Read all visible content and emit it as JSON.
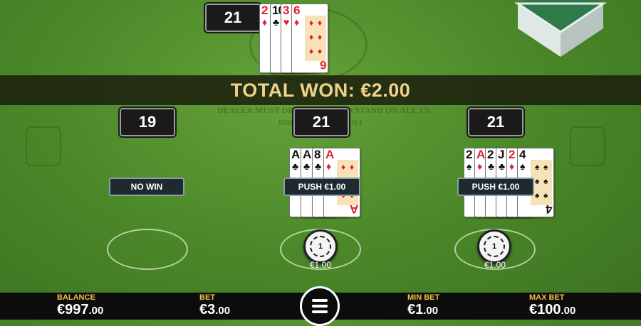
{
  "table": {
    "felt_arc_text": "DEALER MUST DRAW TO 16 AND STAND ON ALL 17s",
    "felt_sub_text": "INSURANCE PAYS 2 TO 1"
  },
  "banner": {
    "text": "TOTAL WON: €2.00"
  },
  "dealer": {
    "score": "21",
    "cards": [
      {
        "rank": "2",
        "suit": "♦",
        "color": "red"
      },
      {
        "rank": "10",
        "suit": "♣",
        "color": "black"
      },
      {
        "rank": "3",
        "suit": "♥",
        "color": "red"
      },
      {
        "rank": "6",
        "suit": "♦",
        "color": "red"
      }
    ]
  },
  "hands": [
    {
      "score": "19",
      "result": "NO WIN",
      "bet": "",
      "cards": []
    },
    {
      "score": "21",
      "result": "PUSH €1.00",
      "bet": "€1.00",
      "chip_value": "1",
      "cards": [
        {
          "rank": "A",
          "suit": "♣",
          "color": "black"
        },
        {
          "rank": "A",
          "suit": "♣",
          "color": "black"
        },
        {
          "rank": "8",
          "suit": "♣",
          "color": "black"
        },
        {
          "rank": "A",
          "suit": "♦",
          "color": "red"
        }
      ]
    },
    {
      "score": "21",
      "result": "PUSH €1.00",
      "bet": "€1.00",
      "chip_value": "1",
      "cards": [
        {
          "rank": "2",
          "suit": "♠",
          "color": "black"
        },
        {
          "rank": "A",
          "suit": "♦",
          "color": "red"
        },
        {
          "rank": "2",
          "suit": "♣",
          "color": "black"
        },
        {
          "rank": "J",
          "suit": "♣",
          "color": "black"
        },
        {
          "rank": "2",
          "suit": "♦",
          "color": "red"
        },
        {
          "rank": "4",
          "suit": "♠",
          "color": "black"
        }
      ]
    }
  ],
  "footer": {
    "balance_label": "BALANCE",
    "balance_main": "€997",
    "balance_cents": ".00",
    "bet_label": "BET",
    "bet_main": "€3",
    "bet_cents": ".00",
    "min_label": "MIN BET",
    "min_main": "€1",
    "min_cents": ".00",
    "max_label": "MAX BET",
    "max_main": "€100",
    "max_cents": ".00"
  },
  "colors": {
    "felt": "#4d8a2a",
    "banner_text": "#f0d28a",
    "label_gold": "#f0c040"
  }
}
